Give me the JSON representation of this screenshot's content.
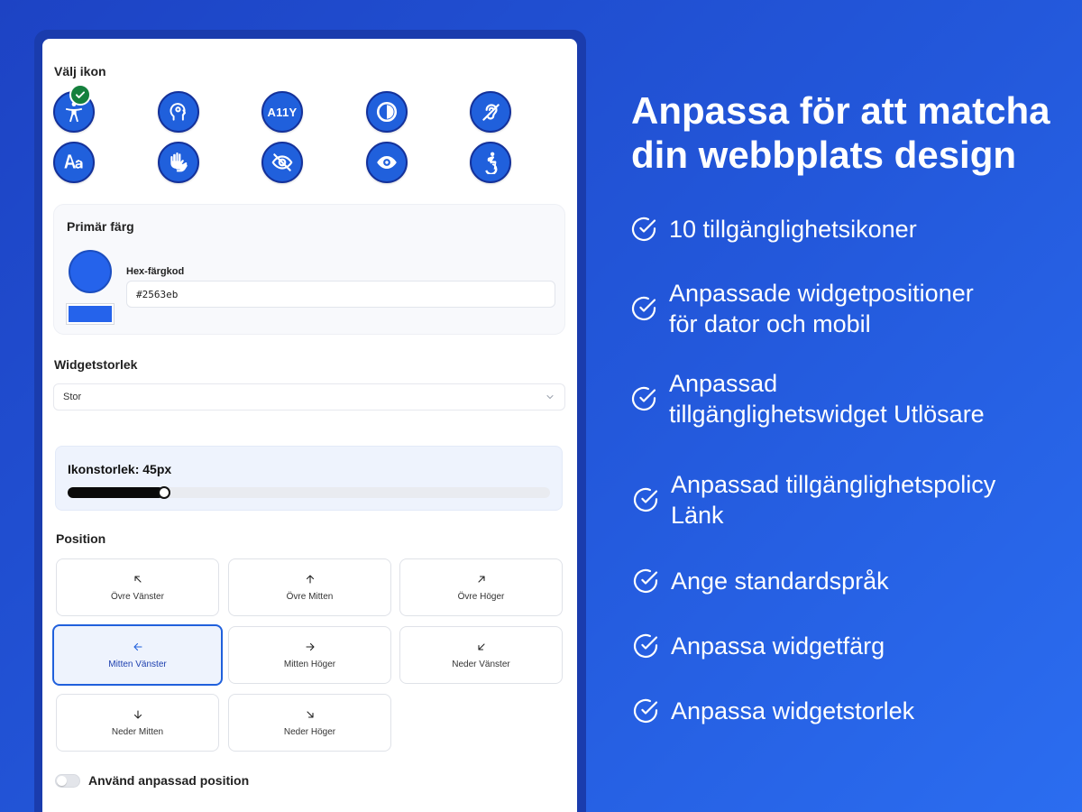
{
  "panel": {
    "icon_section_title": "Välj ikon",
    "icons": [
      {
        "name": "accessibility-person-icon",
        "selected": true
      },
      {
        "name": "head-gear-icon"
      },
      {
        "name": "a11y-text-icon",
        "text": "A11Y"
      },
      {
        "name": "contrast-icon"
      },
      {
        "name": "hearing-impaired-icon"
      },
      {
        "name": "font-aa-icon"
      },
      {
        "name": "sign-language-hands-icon"
      },
      {
        "name": "eye-slash-icon"
      },
      {
        "name": "eye-icon"
      },
      {
        "name": "wheelchair-icon"
      }
    ],
    "primary_color": {
      "title": "Primär färg",
      "hex_label": "Hex-färgkod",
      "hex_value": "#2563eb",
      "color": "#2563eb"
    },
    "widget_size": {
      "title": "Widgetstorlek",
      "value": "Stor"
    },
    "icon_size": {
      "label": "Ikonstorlek: 45px",
      "fraction": 0.2
    },
    "position": {
      "title": "Position",
      "options": [
        {
          "label": "Övre Vänster",
          "arrow": "up-left"
        },
        {
          "label": "Övre Mitten",
          "arrow": "up"
        },
        {
          "label": "Övre Höger",
          "arrow": "up-right"
        },
        {
          "label": "Mitten Vänster",
          "arrow": "left",
          "active": true
        },
        {
          "label": "Mitten Höger",
          "arrow": "right"
        },
        {
          "label": "Neder Vänster",
          "arrow": "down-left"
        },
        {
          "label": "Neder Mitten",
          "arrow": "down"
        },
        {
          "label": "Neder Höger",
          "arrow": "down-right"
        }
      ]
    },
    "custom_position_toggle": {
      "label": "Använd anpassad position",
      "on": false
    }
  },
  "marketing": {
    "headline_line1": "Anpassa för att matcha",
    "headline_line2": "din webbplats design",
    "features": [
      [
        "10 tillgänglighetsikoner"
      ],
      [
        "Anpassade widgetpositioner",
        "för dator och mobil"
      ],
      [
        "Anpassad",
        "tillgänglighetswidget Utlösare"
      ],
      [
        "Anpassad tillgänglighetspolicy",
        "Länk"
      ],
      [
        "Ange standardspråk"
      ],
      [
        "Anpassa widgetfärg"
      ],
      [
        "Anpassa widgetstorlek"
      ]
    ]
  },
  "colors": {
    "accent": "#2060dc",
    "selected_badge": "#15803d",
    "background_start": "#1d43c4",
    "background_end": "#2b6df0"
  }
}
